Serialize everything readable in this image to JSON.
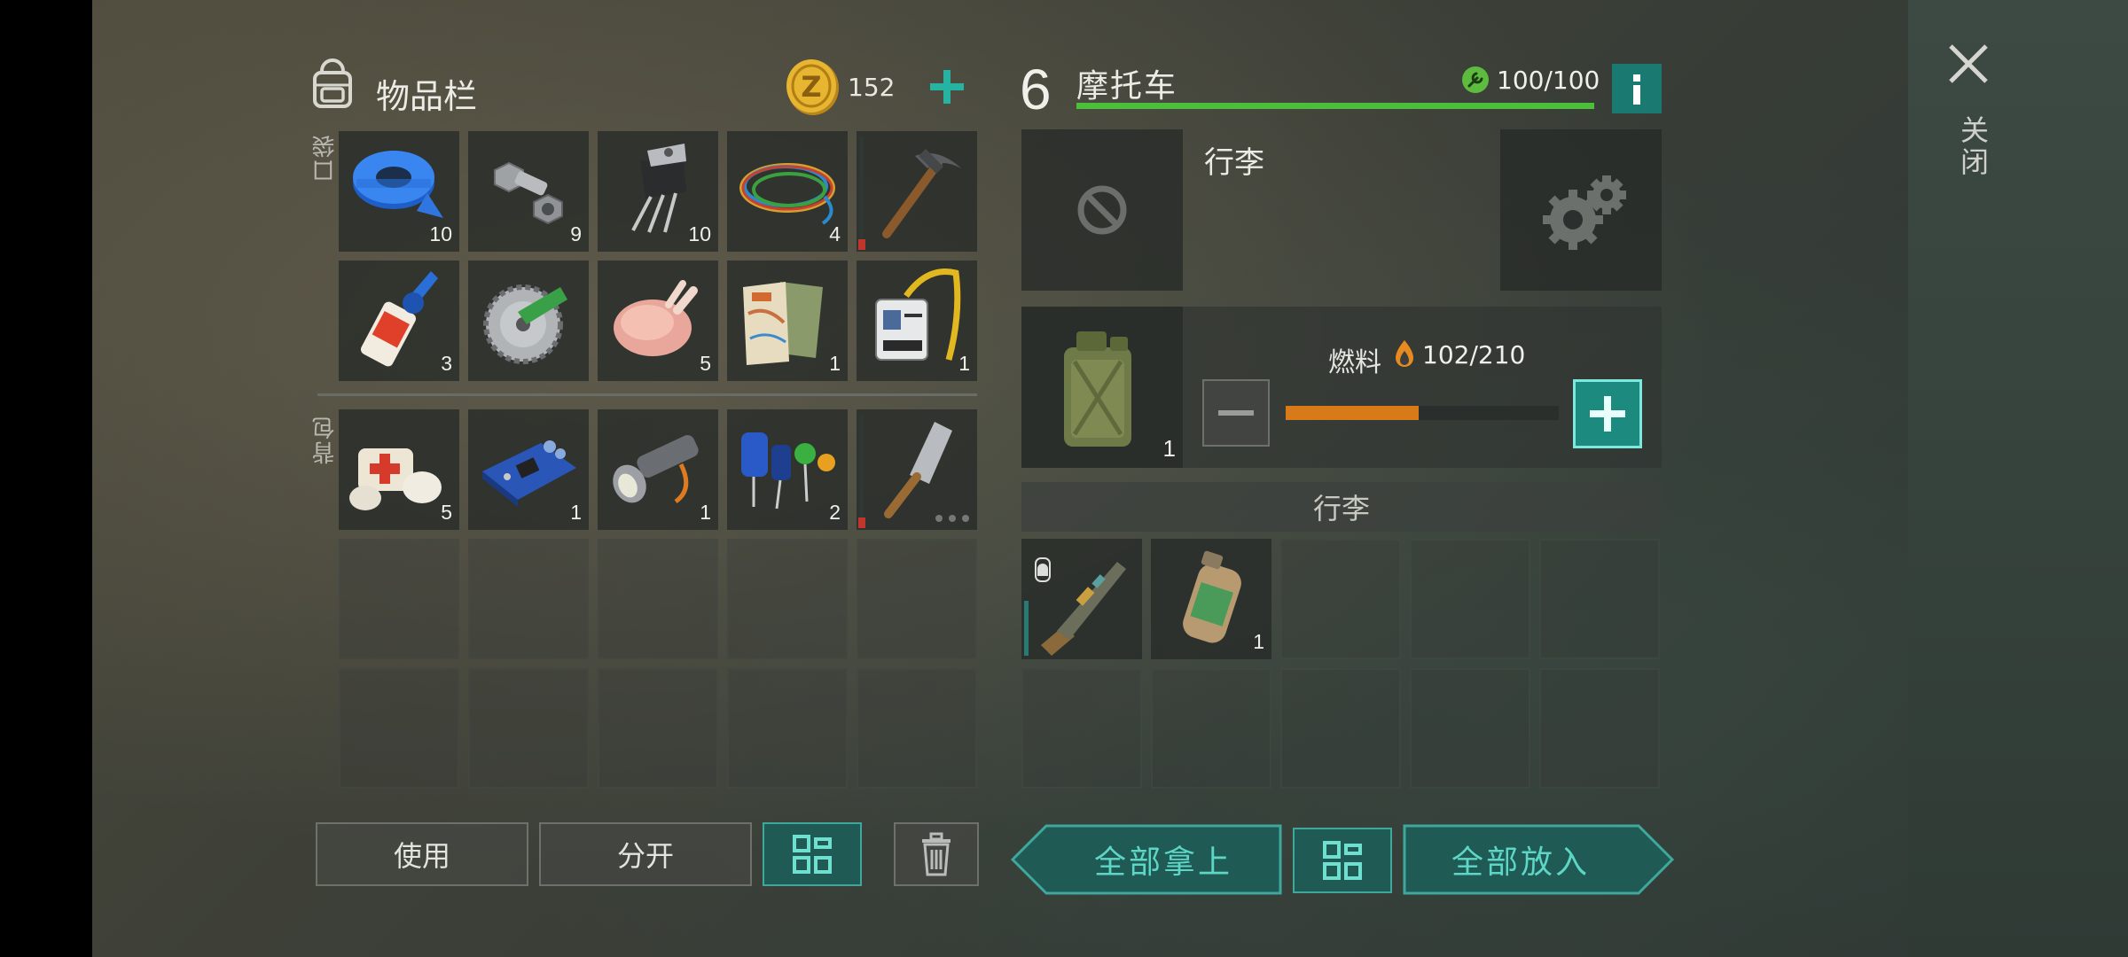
{
  "inventory": {
    "title": "物品栏",
    "coins": "152",
    "pocket_label": "口袋",
    "backpack_label": "背包",
    "pocket_items": [
      {
        "name": "duct-tape",
        "count": "10"
      },
      {
        "name": "bolts-nut",
        "count": "9"
      },
      {
        "name": "transistor",
        "count": "10"
      },
      {
        "name": "wires",
        "count": "4"
      },
      {
        "name": "pickaxe",
        "count": ""
      },
      {
        "name": "glue",
        "count": "3"
      },
      {
        "name": "saw-blade",
        "count": ""
      },
      {
        "name": "raw-chicken",
        "count": "5"
      },
      {
        "name": "map",
        "count": "1"
      },
      {
        "name": "id-badge",
        "count": "1"
      }
    ],
    "backpack_items": [
      {
        "name": "bandages",
        "count": "5"
      },
      {
        "name": "circuit-board",
        "count": "1"
      },
      {
        "name": "flashlight",
        "count": "1"
      },
      {
        "name": "capacitors",
        "count": "2"
      },
      {
        "name": "cleaver",
        "count": ""
      }
    ]
  },
  "vehicle": {
    "level": "6",
    "name": "摩托车",
    "durability": "100/100",
    "durability_fraction": 1.0,
    "trunk_title": "行李",
    "fuel_label": "燃料",
    "fuel_value": "102/210",
    "fuel_fraction": 0.486,
    "canister_count": "1",
    "luggage_header": "行李",
    "luggage_items": [
      {
        "name": "rifle",
        "count": ""
      },
      {
        "name": "gas-cylinder",
        "count": "1"
      }
    ]
  },
  "buttons": {
    "use": "使用",
    "split": "分开",
    "take_all": "全部拿上",
    "put_all": "全部放入",
    "close": "关闭"
  }
}
